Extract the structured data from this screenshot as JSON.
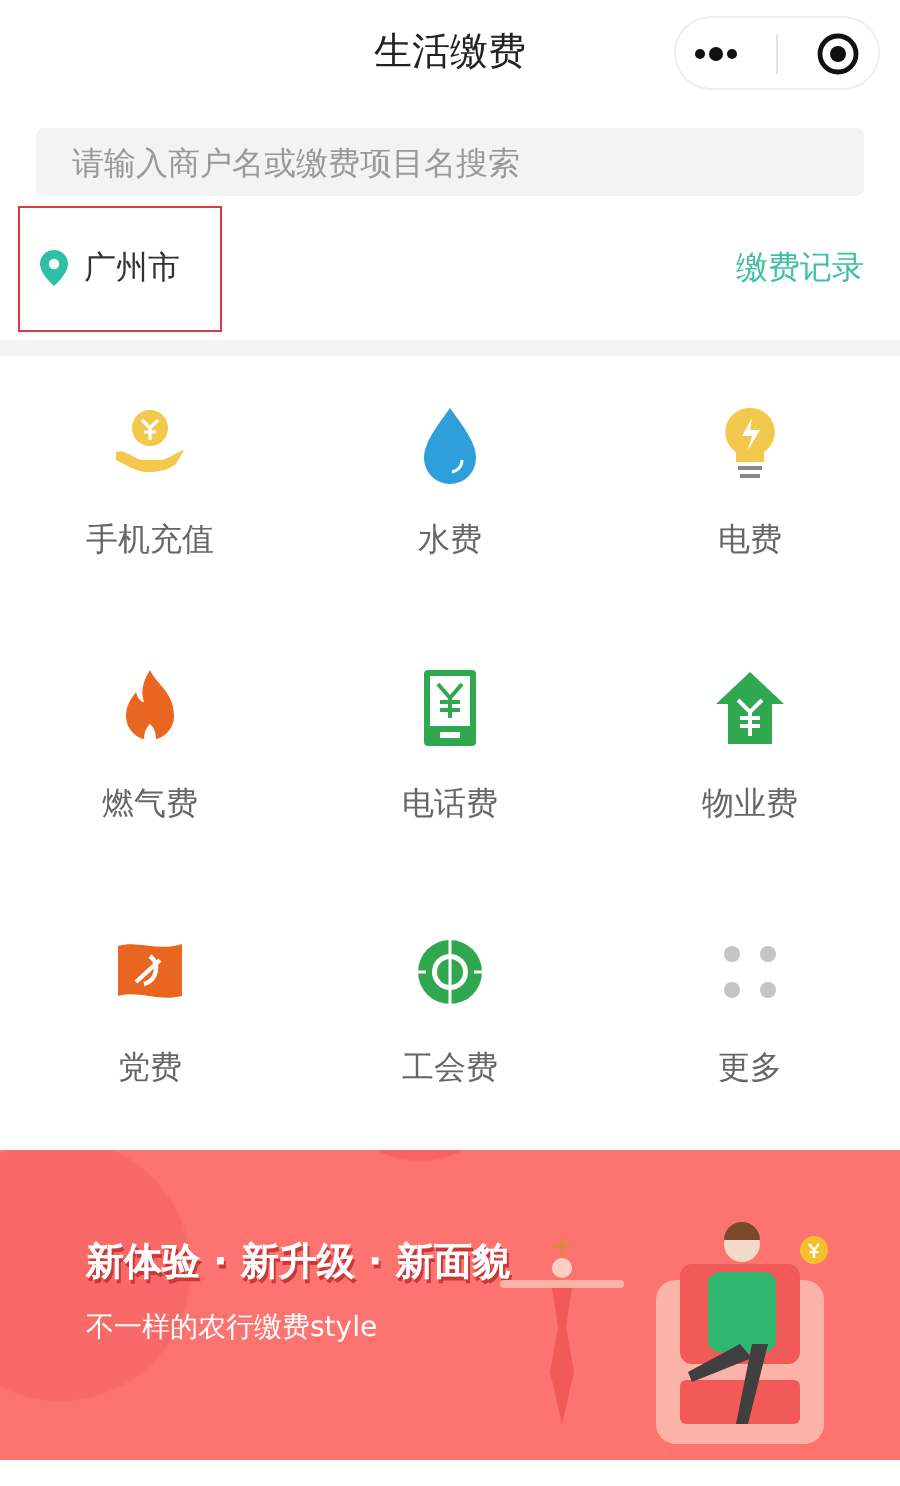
{
  "header": {
    "title": "生活缴费"
  },
  "search": {
    "placeholder": "请输入商户名或缴费项目名搜索"
  },
  "location": {
    "city": "广州市",
    "highlighted": true
  },
  "records_link": "缴费记录",
  "services": [
    {
      "label": "手机充值"
    },
    {
      "label": "水费"
    },
    {
      "label": "电费"
    },
    {
      "label": "燃气费"
    },
    {
      "label": "电话费"
    },
    {
      "label": "物业费"
    },
    {
      "label": "党费"
    },
    {
      "label": "工会费"
    },
    {
      "label": "更多"
    }
  ],
  "banner": {
    "headline": "新体验 · 新升级 · 新面貌",
    "subline": "不一样的农行缴费style"
  }
}
